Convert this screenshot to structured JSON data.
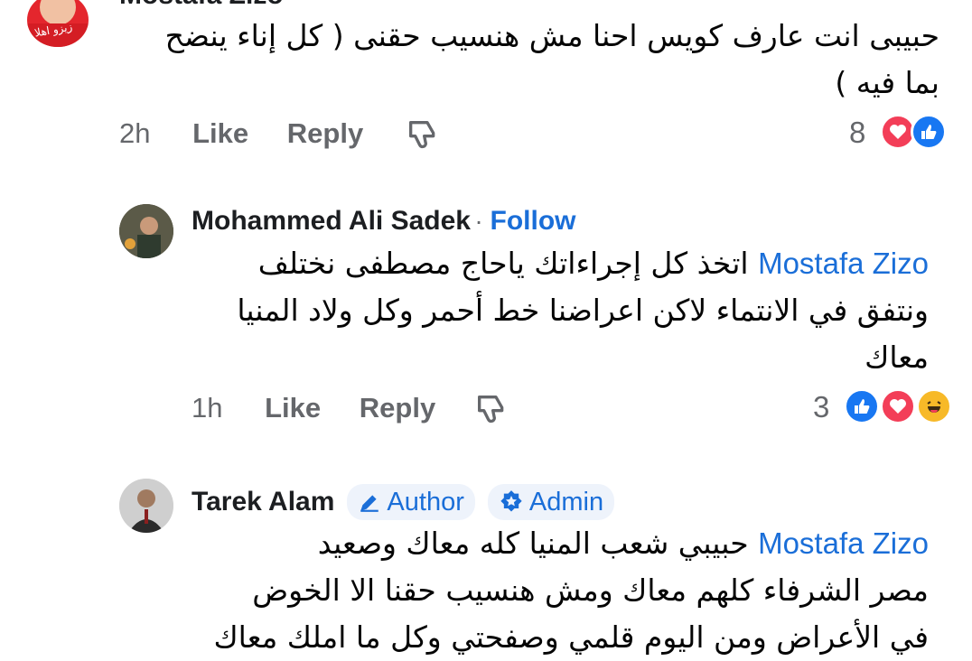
{
  "comments": [
    {
      "author": "Mostafa Zizo",
      "lines": [
        "حبيبى انت عارف كويس احنا مش هنسيب حقنى ( كل إناء ينضح",
        "بما فيه )"
      ],
      "time": "2h",
      "like_label": "Like",
      "reply_label": "Reply",
      "reaction_count": "8",
      "reactions": [
        "heart",
        "like"
      ],
      "avatar_text": "زيزو اهلا"
    },
    {
      "author": "Mohammed Ali Sadek",
      "follow_label": "Follow",
      "mention": "Mostafa Zizo",
      "lines": [
        " اتخذ كل إجراءاتك ياحاج مصطفى نختلف",
        "ونتفق في الانتماء لاكن اعراضنا خط أحمر وكل ولاد المنيا",
        "معاك"
      ],
      "time": "1h",
      "like_label": "Like",
      "reply_label": "Reply",
      "reaction_count": "3",
      "reactions": [
        "like",
        "heart",
        "haha"
      ]
    },
    {
      "author": "Tarek Alam",
      "badges": [
        "Author",
        "Admin"
      ],
      "mention": "Mostafa Zizo",
      "lines": [
        " حبيبي شعب المنيا كله معاك وصعيد",
        "مصر الشرفاء كلهم معاك ومش هنسيب حقنا الا الخوض",
        "في الأعراض ومن اليوم قلمي وصفحتي وكل ما املك معاك"
      ]
    }
  ],
  "colors": {
    "link": "#1a6ed8",
    "muted": "#65676b",
    "like": "#1877f2",
    "heart": "#f33e58",
    "haha": "#f7b928"
  },
  "icons": [
    "dislike-icon",
    "pencil-icon",
    "admin-star-icon"
  ]
}
